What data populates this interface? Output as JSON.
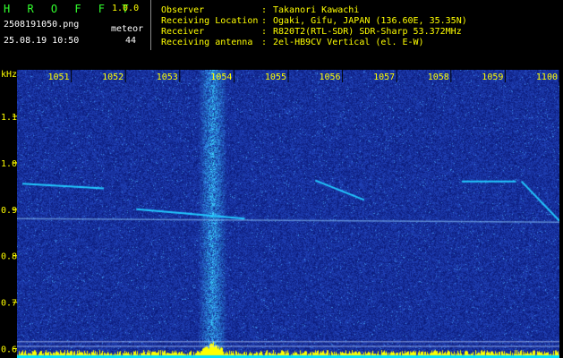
{
  "app": {
    "name": "H R O F F T",
    "version": "1.0.0",
    "filename": "2508191050.png",
    "datetime": "25.08.19 10:50",
    "meteor_label": "meteor",
    "meteor_count": "44"
  },
  "info": {
    "observer_label": "Observer",
    "observer_value": "Takanori Kawachi",
    "location_label": "Receiving Location",
    "location_value": "Ogaki, Gifu, JAPAN (136.60E, 35.35N)",
    "receiver_label": "Receiver",
    "receiver_value": "R820T2(RTL-SDR) SDR-Sharp 53.372MHz",
    "antenna_label": "Receiving antenna",
    "antenna_value": "2el-HB9CV Vertical (el. E-W)",
    "sep": ":"
  },
  "colors": {
    "label_green": "#32ff2e",
    "version_yellow": "#ffff00",
    "axis_yellow": "#ffff00",
    "background_blue": "#1a2a8c",
    "echo_cyan": "#22c8ff",
    "signal_bar_yellow": "#ffff00",
    "baseline_cyan": "#00e0ff"
  },
  "chart_data": {
    "type": "heatmap",
    "xlabel": "",
    "ylabel": "kHz",
    "x_ticks": [
      "1051",
      "1052",
      "1053",
      "1054",
      "1055",
      "1056",
      "1057",
      "1058",
      "1059",
      "1100"
    ],
    "y_ticks": [
      "1.1",
      "1.0",
      "0.9",
      "0.8",
      "0.7",
      "0.6"
    ],
    "y_tick_values": [
      1.1,
      1.0,
      0.9,
      0.8,
      0.7,
      0.6
    ],
    "ylim": [
      0.58,
      1.2
    ],
    "x_time_range": [
      "10:50",
      "11:00"
    ],
    "carrier_khz": 0.88,
    "bright_band_time": "10:53.6",
    "echo_traces": [
      {
        "start": "10:50.1",
        "end": "10:51.6",
        "khz_start": 0.955,
        "khz_end": 0.945
      },
      {
        "start": "10:52.2",
        "end": "10:54.2",
        "khz_start": 0.9,
        "khz_end": 0.88
      },
      {
        "start": "10:55.5",
        "end": "10:56.4",
        "khz_start": 0.962,
        "khz_end": 0.92
      },
      {
        "start": "10:58.2",
        "end": "10:59.2",
        "khz_start": 0.96,
        "khz_end": 0.96
      },
      {
        "start": "10:59.3",
        "end": "11:00",
        "khz_start": 0.96,
        "khz_end": 0.875
      }
    ],
    "grid": false
  }
}
